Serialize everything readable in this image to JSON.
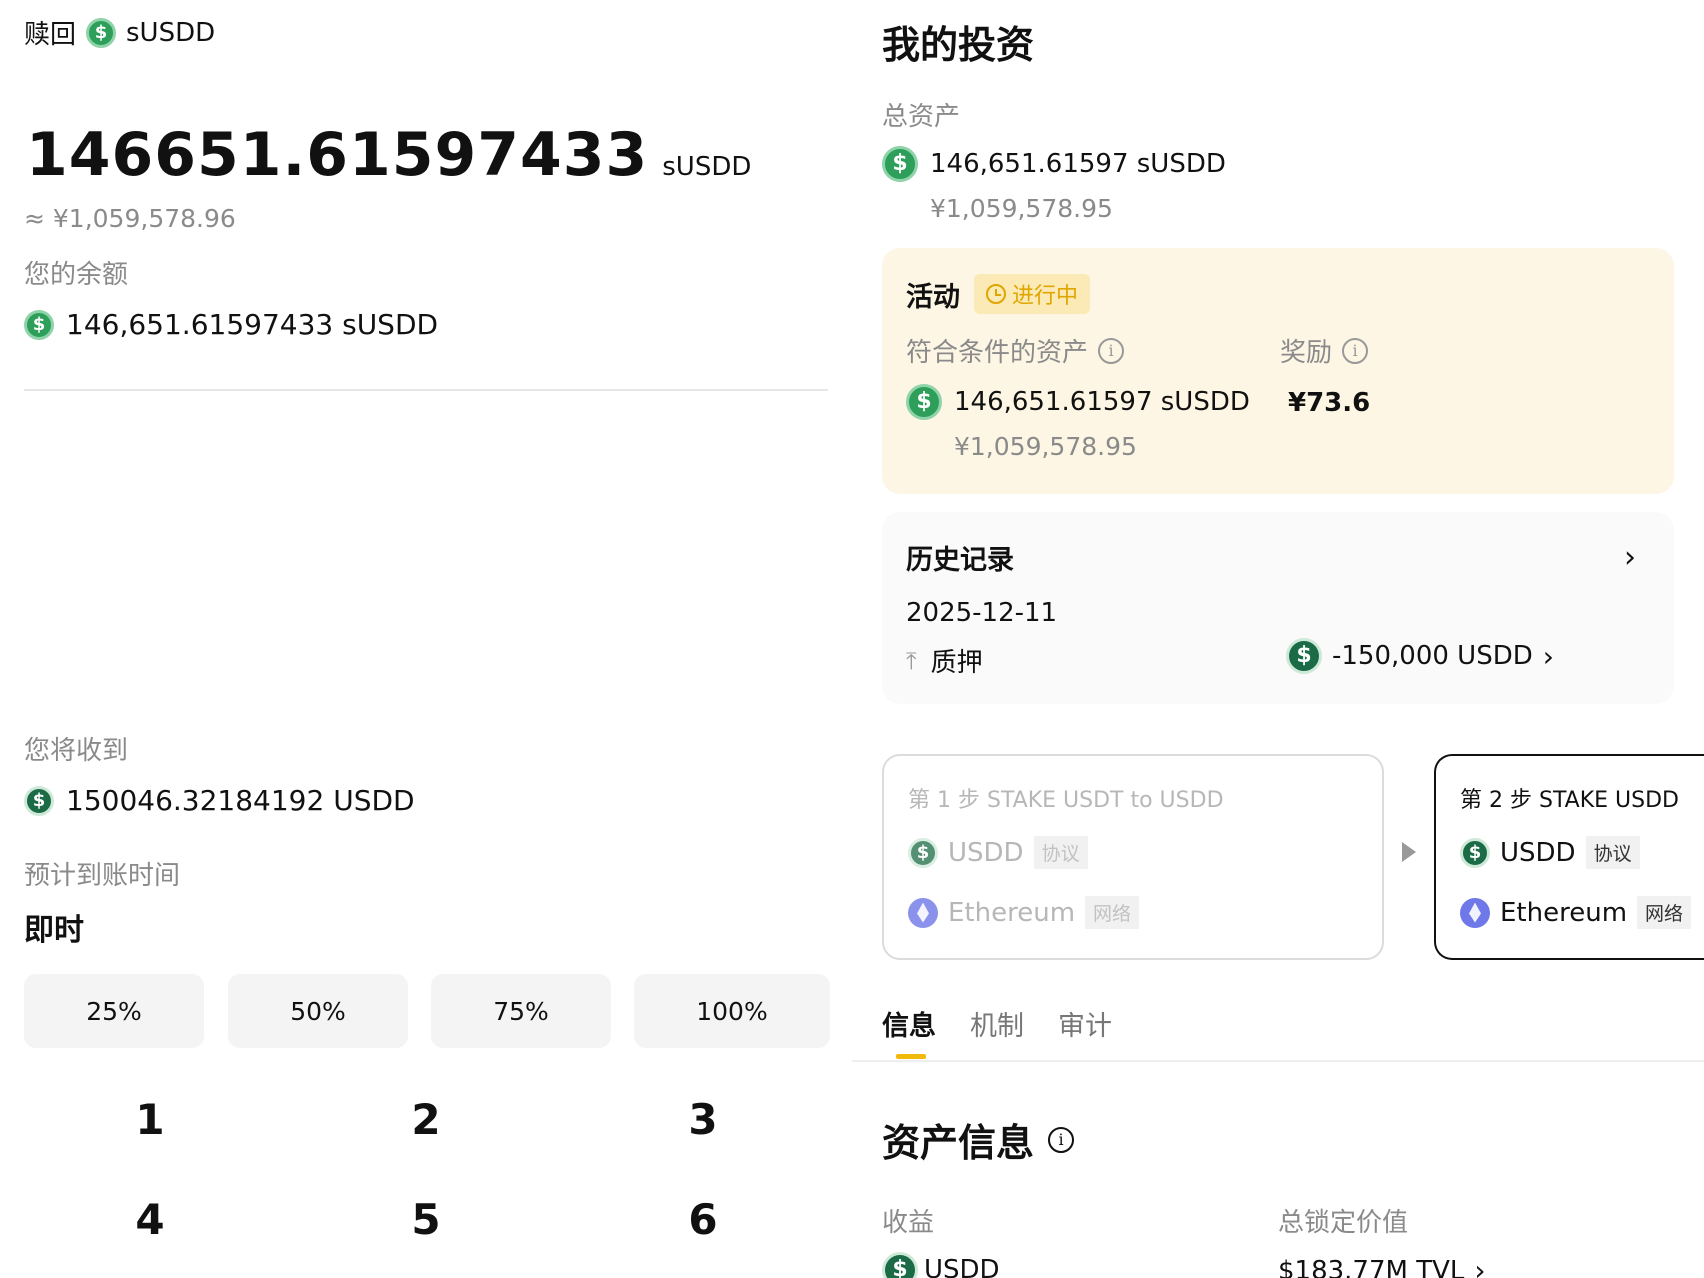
{
  "left": {
    "header": {
      "title": "赎回",
      "token": "sUSDD"
    },
    "amount": {
      "value": "146651.61597433",
      "unit": "sUSDD",
      "fiat": "≈ ¥1,059,578.96"
    },
    "balance": {
      "label": "您的余额",
      "value": "146,651.61597433 sUSDD"
    },
    "receive": {
      "label": "您将收到",
      "value": "150046.32184192 USDD"
    },
    "eta": {
      "label": "预计到账时间",
      "value": "即时"
    },
    "percent_buttons": [
      "25%",
      "50%",
      "75%",
      "100%"
    ],
    "keypad": [
      "1",
      "2",
      "3",
      "4",
      "5",
      "6"
    ]
  },
  "right": {
    "title": "我的投资",
    "total": {
      "label": "总资产",
      "value": "146,651.61597 sUSDD",
      "fiat": "¥1,059,578.95"
    },
    "activity": {
      "title": "活动",
      "status": "进行中",
      "eligible_label": "符合条件的资产",
      "reward_label": "奖励",
      "eligible_value": "146,651.61597 sUSDD",
      "eligible_fiat": "¥1,059,578.95",
      "reward_value": "¥73.6"
    },
    "history": {
      "title": "历史记录",
      "date": "2025-12-11",
      "action": "质押",
      "amount": "-150,000 USDD"
    },
    "steps": [
      {
        "title": "第 1 步  STAKE USDT to USDD",
        "token": "USDD",
        "token_tag": "协议",
        "network": "Ethereum",
        "network_tag": "网络"
      },
      {
        "title": "第 2 步  STAKE USDD",
        "token": "USDD",
        "token_tag": "协议",
        "network": "Ethereum",
        "network_tag": "网络"
      }
    ],
    "tabs": [
      "信息",
      "机制",
      "审计"
    ],
    "asset_info": {
      "title": "资产信息",
      "yield_label": "收益",
      "tvl_label": "总锁定价值",
      "yield_value": "USDD",
      "tvl_value": "$183.77M TVL"
    }
  },
  "colors": {
    "brand_yellow": "#f0b90b",
    "activity_bg": "#fdf6e4",
    "coin_green": "#2e9e5b"
  }
}
